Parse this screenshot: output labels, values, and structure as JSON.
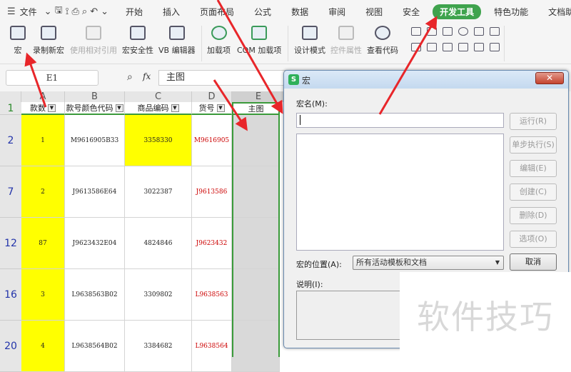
{
  "menu": {
    "file": "文件",
    "tabs": [
      "开始",
      "插入",
      "页面布局",
      "公式",
      "数据",
      "审阅",
      "视图",
      "安全",
      "开发工具",
      "特色功能",
      "文档助手"
    ],
    "active_tab": "开发工具"
  },
  "ribbon": {
    "items": [
      "宏",
      "录制新宏",
      "使用相对引用",
      "宏安全性",
      "VB 编辑器",
      "加载项",
      "COM 加载项",
      "设计模式",
      "控件属性",
      "查看代码"
    ],
    "disabled": [
      "使用相对引用",
      "控件属性"
    ]
  },
  "formula_bar": {
    "name_box": "E1",
    "fx": "fx",
    "value": "主图"
  },
  "sheet": {
    "columns": [
      "A",
      "B",
      "C",
      "D",
      "E"
    ],
    "headers": [
      "款数",
      "款号颜色代码",
      "商品编码",
      "货号",
      "主图"
    ],
    "rows": [
      {
        "num": "2",
        "cells": [
          "1",
          "M9616905B33",
          "3358330",
          "M9616905",
          ""
        ]
      },
      {
        "num": "7",
        "cells": [
          "2",
          "J9613586E64",
          "3022387",
          "J9613586",
          ""
        ]
      },
      {
        "num": "12",
        "cells": [
          "87",
          "J9623432E04",
          "4824846",
          "J9623432",
          ""
        ]
      },
      {
        "num": "16",
        "cells": [
          "3",
          "L9638563B02",
          "3309802",
          "L9638563",
          ""
        ]
      },
      {
        "num": "20",
        "cells": [
          "4",
          "L9638564B02",
          "3384682",
          "L9638564",
          ""
        ]
      }
    ],
    "header_row": "1"
  },
  "dialog": {
    "title": "宏",
    "name_label": "宏名(M):",
    "name_value": "",
    "buttons": [
      "运行(R)",
      "单步执行(S)",
      "编辑(E)",
      "创建(C)",
      "删除(D)",
      "选项(O)"
    ],
    "cancel": "取消",
    "location_label": "宏的位置(A):",
    "location_value": "所有活动模板和文档",
    "desc_label": "说明(I):"
  },
  "watermark": "软件技巧",
  "colors": {
    "accent": "#3fa34d",
    "highlight": "#ffff00",
    "arrow": "#e8262a"
  }
}
